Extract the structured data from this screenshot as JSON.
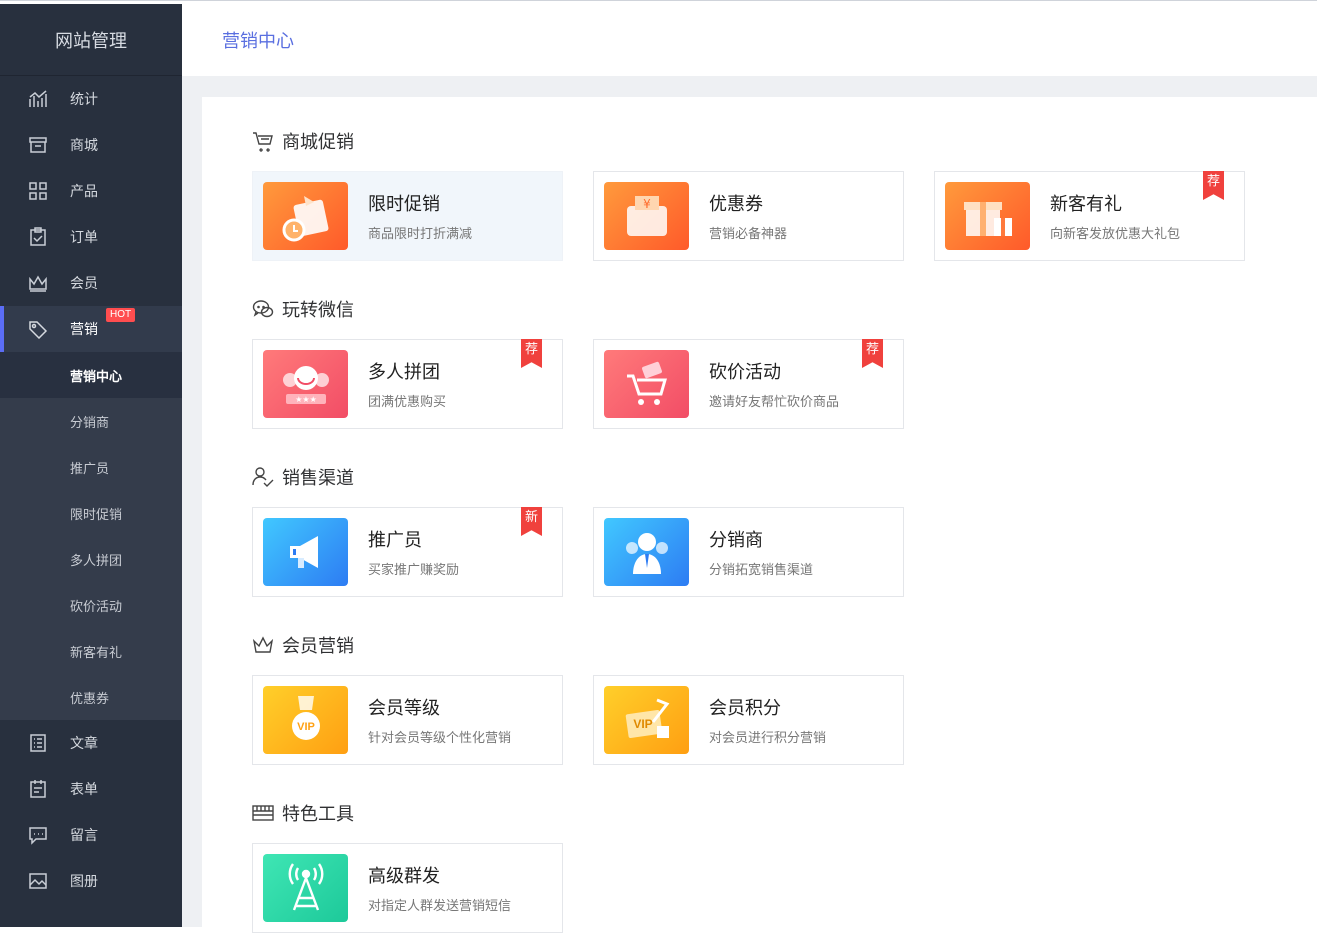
{
  "sidebar": {
    "brand": "网站管理",
    "top_items": [
      {
        "label": "统计",
        "icon": "chart-icon"
      },
      {
        "label": "商城",
        "icon": "store-icon"
      },
      {
        "label": "产品",
        "icon": "grid-icon"
      },
      {
        "label": "订单",
        "icon": "clipboard-check-icon"
      },
      {
        "label": "会员",
        "icon": "crown-icon"
      }
    ],
    "marketing": {
      "label": "营销",
      "badge": "HOT",
      "icon": "tag-icon"
    },
    "sub_items": [
      "营销中心",
      "分销商",
      "推广员",
      "限时促销",
      "多人拼团",
      "砍价活动",
      "新客有礼",
      "优惠券"
    ],
    "bottom_items": [
      {
        "label": "文章",
        "icon": "list-icon"
      },
      {
        "label": "表单",
        "icon": "form-icon"
      },
      {
        "label": "留言",
        "icon": "message-icon"
      },
      {
        "label": "图册",
        "icon": "image-icon"
      }
    ]
  },
  "header": {
    "title": "营销中心"
  },
  "sections": [
    {
      "title": "商城促销",
      "icon": "cart-icon",
      "cards": [
        {
          "title": "限时促销",
          "desc": "商品限时打折满减",
          "icon": "gift-clock-icon"
        },
        {
          "title": "优惠券",
          "desc": "营销必备神器",
          "icon": "coupon-icon"
        },
        {
          "title": "新客有礼",
          "desc": "向新客发放优惠大礼包",
          "icon": "gift-box-icon",
          "tag": "荐"
        }
      ]
    },
    {
      "title": "玩转微信",
      "icon": "wechat-icon",
      "cards": [
        {
          "title": "多人拼团",
          "desc": "团满优惠购买",
          "icon": "group-icon",
          "tag": "荐"
        },
        {
          "title": "砍价活动",
          "desc": "邀请好友帮忙砍价商品",
          "icon": "bargain-cart-icon",
          "tag": "荐"
        }
      ]
    },
    {
      "title": "销售渠道",
      "icon": "user-channel-icon",
      "cards": [
        {
          "title": "推广员",
          "desc": "买家推广赚奖励",
          "icon": "megaphone-icon",
          "tag": "新"
        },
        {
          "title": "分销商",
          "desc": "分销拓宽销售渠道",
          "icon": "distributors-icon"
        }
      ]
    },
    {
      "title": "会员营销",
      "icon": "crown-icon",
      "cards": [
        {
          "title": "会员等级",
          "desc": "针对会员等级个性化营销",
          "icon": "vip-medal-icon"
        },
        {
          "title": "会员积分",
          "desc": "对会员进行积分营销",
          "icon": "vip-points-icon"
        }
      ]
    },
    {
      "title": "特色工具",
      "icon": "toolbox-icon",
      "cards": [
        {
          "title": "高级群发",
          "desc": "对指定人群发送营销短信",
          "icon": "broadcast-tower-icon"
        }
      ]
    }
  ]
}
